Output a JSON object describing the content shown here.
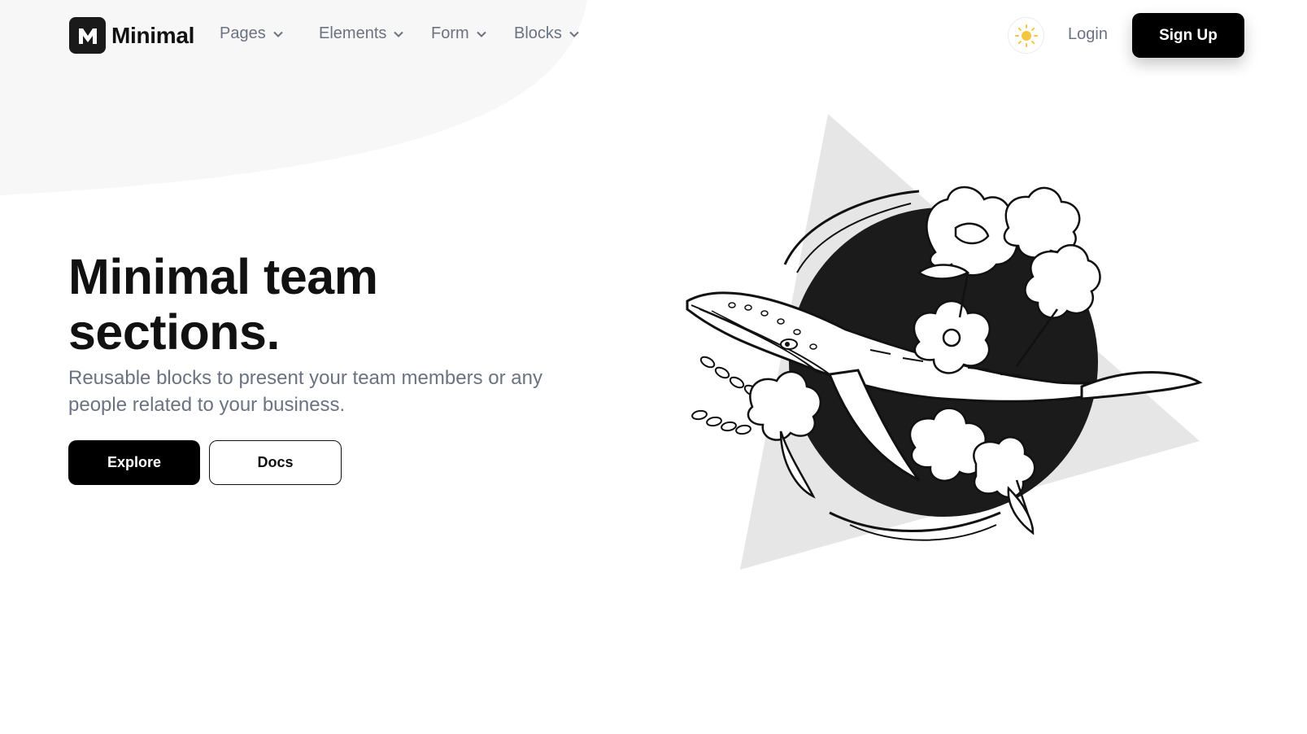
{
  "brand": {
    "name": "Minimal",
    "logo_letter": "M"
  },
  "nav": {
    "items": [
      {
        "label": "Pages",
        "icon": "chevron-down-icon"
      },
      {
        "label": "Elements",
        "icon": "chevron-down-icon"
      },
      {
        "label": "Form",
        "icon": "chevron-down-icon"
      },
      {
        "label": "Blocks",
        "icon": "chevron-down-icon"
      }
    ]
  },
  "header": {
    "theme_icon": "sun-icon",
    "login_label": "Login",
    "signup_label": "Sign Up"
  },
  "hero": {
    "title_line1": "Minimal team",
    "title_line2": "sections.",
    "subtitle": "Reusable blocks to present your team members or any people related to your business.",
    "explore_label": "Explore",
    "docs_label": "Docs"
  },
  "colors": {
    "accent": "#000000",
    "muted_text": "#6b7280",
    "sun": "#f5c542",
    "blob": "#f7f7f7",
    "triangle": "#e6e6e6"
  }
}
